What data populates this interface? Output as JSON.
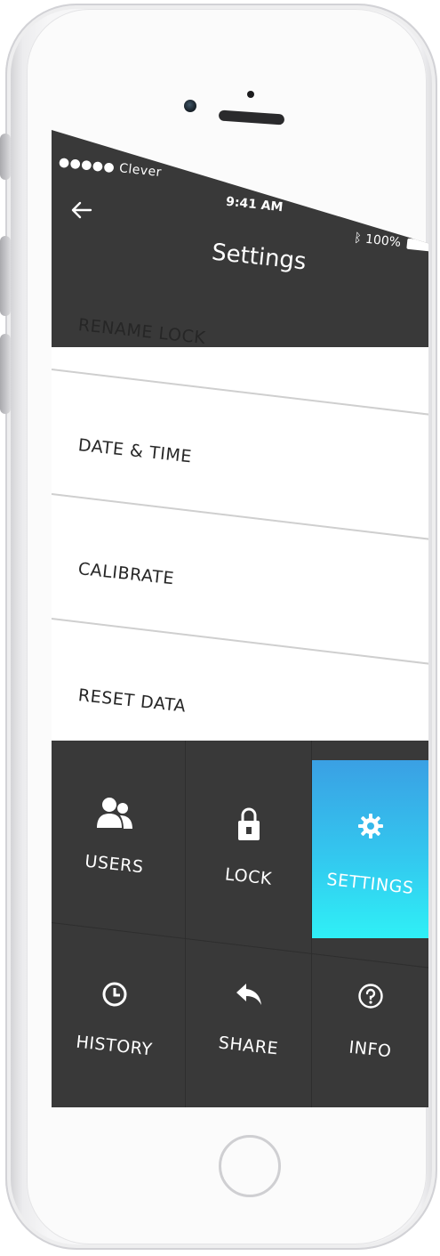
{
  "status_bar": {
    "carrier": "●●●●● Clever",
    "time": "9:41 AM",
    "battery": "100%"
  },
  "header": {
    "title": "Settings",
    "back_icon": "back-arrow-icon"
  },
  "settings": {
    "items": [
      {
        "label": "RENAME LOCK"
      },
      {
        "label": "DATE & TIME"
      },
      {
        "label": "CALIBRATE"
      },
      {
        "label": "RESET DATA"
      }
    ]
  },
  "nav": {
    "tiles": [
      {
        "label": "USERS",
        "icon": "users-icon",
        "active": false
      },
      {
        "label": "LOCK",
        "icon": "lock-icon",
        "active": false
      },
      {
        "label": "SETTINGS",
        "icon": "gear-icon",
        "active": true
      },
      {
        "label": "HISTORY",
        "icon": "clock-icon",
        "active": false
      },
      {
        "label": "SHARE",
        "icon": "share-icon",
        "active": false
      },
      {
        "label": "INFO",
        "icon": "help-icon",
        "active": false
      }
    ]
  },
  "colors": {
    "header_bg": "#393939",
    "grid_bg": "#393939",
    "active_top": "#3aa0e4",
    "active_bottom": "#2ff0f6",
    "text_dark": "#262626"
  }
}
